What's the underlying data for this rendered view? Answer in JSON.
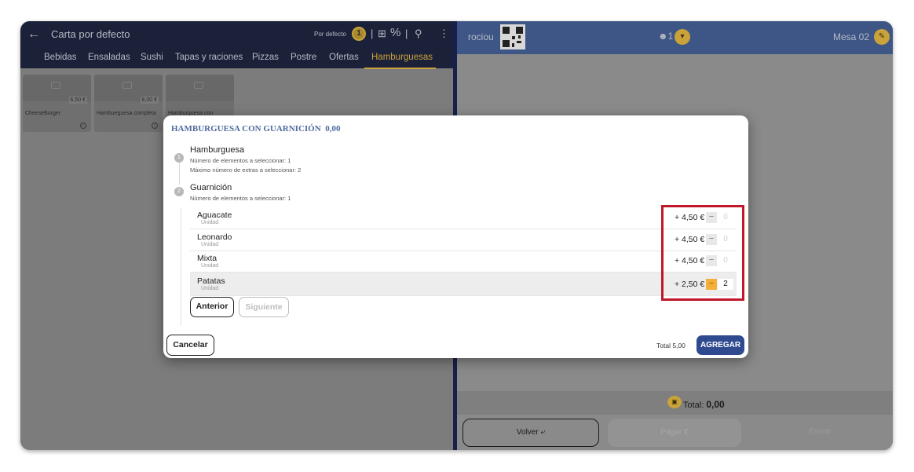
{
  "left": {
    "title": "Carta por defecto",
    "back_icon": "arrow-left-icon",
    "por_defecto": "Por defecto",
    "coin_count": "1",
    "tabs": [
      "Bebidas",
      "Ensaladas",
      "Sushi",
      "Tapas y raciones",
      "Pizzas",
      "Postre",
      "Ofertas",
      "Hamburguesas"
    ],
    "active_tab": "Hamburguesas",
    "cards": [
      {
        "name": "CheeseBurger",
        "price": "6,50 €"
      },
      {
        "name": "Hambueguesa completa",
        "price": "8,00 €"
      },
      {
        "name": "Hamburguesa con",
        "price": ""
      }
    ]
  },
  "right": {
    "name": "rociou",
    "diners": "1",
    "table": "Mesa 02",
    "total_label": "Total:",
    "total_value": "0,00",
    "volver": "Volver",
    "pagar": "Pagar",
    "enviar": "Enviar"
  },
  "modal": {
    "title": "HAMBURGUESA CON GUARNICIÓN",
    "title_price": "0,00",
    "steps": [
      {
        "num": "1",
        "title": "Hamburguesa",
        "lines": [
          "Número de elementos a seleccionar: 1",
          "Máximo número de extras a seleccionar: 2"
        ]
      },
      {
        "num": "2",
        "title": "Guarnición",
        "lines": [
          "Número de elementos a seleccionar: 1"
        ]
      }
    ],
    "options": [
      {
        "name": "Aguacate",
        "unit": "Unidad",
        "price": "+ 4,50 €",
        "qty": "0"
      },
      {
        "name": "Leonardo",
        "unit": "Unidad",
        "price": "+ 4,50 €",
        "qty": "0"
      },
      {
        "name": "Mixta",
        "unit": "Unidad",
        "price": "+ 4,50 €",
        "qty": "0"
      },
      {
        "name": "Patatas",
        "unit": "Unidad",
        "price": "+ 2,50 €",
        "qty": "2"
      }
    ],
    "minus": "−",
    "anterior": "Anterior",
    "siguiente": "Siguiente",
    "cancelar": "Cancelar",
    "total": "Total 5,00",
    "agregar": "AGREGAR"
  },
  "colors": {
    "header_dark": "#1b2139",
    "accent_gold": "#c9a23a",
    "primary_blue": "#2f4a8e",
    "highlight_red": "#c0172a"
  }
}
